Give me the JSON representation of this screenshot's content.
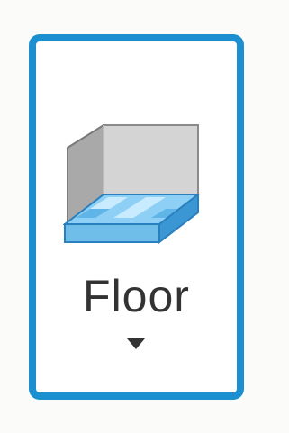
{
  "ribbon_button": {
    "label": "Floor",
    "icon": "floor-icon",
    "dropdown_icon": "triangle-down-icon",
    "selected": true
  },
  "colors": {
    "selection_border": "#1c8fd0",
    "label_text": "#333333",
    "box_gray": "#cfcfcf",
    "slab_blue": "#7cc4ef"
  }
}
